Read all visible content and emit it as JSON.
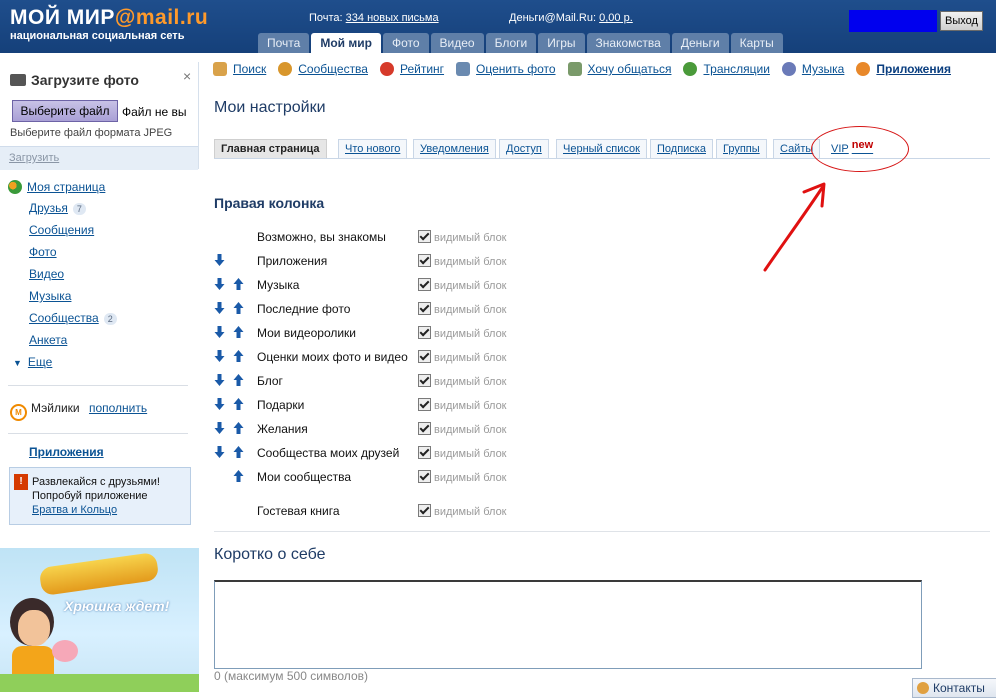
{
  "header": {
    "logo_main": "МОЙ МИР",
    "logo_domain": "@mail.ru",
    "logo_dot": "·",
    "logo_sub": "национальная социальная сеть",
    "mail_label": "Почта: ",
    "mail_link": "334 новых письма",
    "money_label": "Деньги@Mail.Ru: ",
    "money_link": "0,00 р.",
    "exit_label": "Выход",
    "nav": [
      {
        "label": "Почта"
      },
      {
        "label": "Мой мир"
      },
      {
        "label": "Фото"
      },
      {
        "label": "Видео"
      },
      {
        "label": "Блоги"
      },
      {
        "label": "Игры"
      },
      {
        "label": "Знакомства"
      },
      {
        "label": "Деньги"
      },
      {
        "label": "Карты"
      }
    ]
  },
  "upload": {
    "title": "Загрузите фото",
    "close": "×",
    "choose_button": "Выберите файл",
    "no_file": "Файл не вы",
    "hint": "Выберите файл формата JPEG",
    "upload_link": "Загрузить"
  },
  "sidebar": {
    "my_page": "Моя страница",
    "items": [
      {
        "label": "Друзья",
        "badge": "7"
      },
      {
        "label": "Сообщения",
        "badge": ""
      },
      {
        "label": "Фото",
        "badge": ""
      },
      {
        "label": "Видео",
        "badge": ""
      },
      {
        "label": "Музыка",
        "badge": ""
      },
      {
        "label": "Сообщества",
        "badge": "2"
      },
      {
        "label": "Анкета",
        "badge": ""
      }
    ],
    "more": "Еще",
    "mailiki_label": "Мэйлики",
    "mailiki_link": "пополнить",
    "apps_link": "Приложения",
    "promo_line1": "Развлекайся с друзьями!",
    "promo_line2": "Попробуй приложение",
    "promo_link": "Братва и Кольцо",
    "banner_slogan": "Хрюшка ждет!"
  },
  "sections": [
    {
      "label": "Поиск",
      "icon_color": "#d9a24a"
    },
    {
      "label": "Сообщества",
      "icon_color": "#d8962c"
    },
    {
      "label": "Рейтинг",
      "icon_color": "#d63a2a"
    },
    {
      "label": "Оценить фото",
      "icon_color": "#6a8ab0"
    },
    {
      "label": "Хочу общаться",
      "icon_color": "#7a9a6a"
    },
    {
      "label": "Трансляции",
      "icon_color": "#4a9a3a"
    },
    {
      "label": "Музыка",
      "icon_color": "#6a7ab8"
    },
    {
      "label": "Приложения",
      "icon_color": "#e8882a"
    }
  ],
  "page_title": "Мои настройки",
  "tabs": [
    {
      "label": "Главная страница"
    },
    {
      "label": "Что нового"
    },
    {
      "label": "Уведомления"
    },
    {
      "label": "Доступ"
    },
    {
      "label": "Черный список"
    },
    {
      "label": "Подписка"
    },
    {
      "label": "Группы"
    },
    {
      "label": "Сайты"
    },
    {
      "label": "VIP",
      "extra": "new"
    }
  ],
  "right_column": {
    "title": "Правая колонка",
    "visible_label": "видимый блок",
    "blocks": [
      {
        "name": "Возможно, вы знакомы",
        "down": false,
        "up": false
      },
      {
        "name": "Приложения",
        "down": true,
        "up": false
      },
      {
        "name": "Музыка",
        "down": true,
        "up": true
      },
      {
        "name": "Последние фото",
        "down": true,
        "up": true
      },
      {
        "name": "Мои видеоролики",
        "down": true,
        "up": true
      },
      {
        "name": "Оценки моих фото и видео",
        "down": true,
        "up": true
      },
      {
        "name": "Блог",
        "down": true,
        "up": true
      },
      {
        "name": "Подарки",
        "down": true,
        "up": true
      },
      {
        "name": "Желания",
        "down": true,
        "up": true
      },
      {
        "name": "Сообщества моих друзей",
        "down": true,
        "up": true
      },
      {
        "name": "Мои сообщества",
        "down": false,
        "up": true
      },
      {
        "name": "Гостевая книга",
        "down": false,
        "up": false
      }
    ]
  },
  "about": {
    "title": "Коротко о себе",
    "value": "",
    "char_hint": "0 (максимум 500 символов)"
  },
  "contacts_label": "Контакты",
  "colors": {
    "header_bg": "#1a4784",
    "link": "#0b5394",
    "accent_red": "#d61414",
    "logo_orange": "#ff9a2b"
  }
}
